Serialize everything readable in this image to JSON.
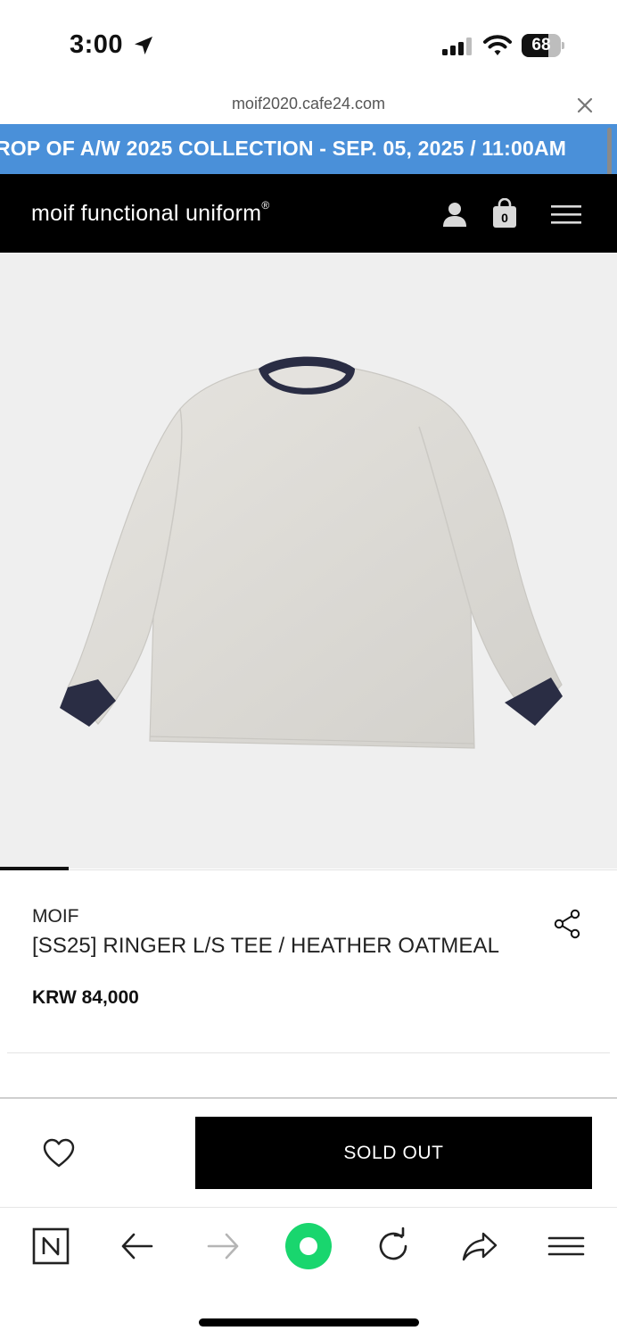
{
  "status_bar": {
    "time": "3:00",
    "battery_level": "68",
    "battery_fraction": 0.68
  },
  "browser": {
    "url": "moif2020.cafe24.com"
  },
  "banner": {
    "text": "ROP OF A/W 2025 COLLECTION - SEP. 05, 2025 / 11:00AM",
    "color": "#4a90d9"
  },
  "header": {
    "logo": "moif functional uniform",
    "logo_mark": "®",
    "cart_count": "0"
  },
  "gallery": {
    "image": "long-sleeve ringer tee, heather oatmeal body with navy collar and cuffs",
    "position": 1
  },
  "product": {
    "brand": "MOIF",
    "name": "[SS25] RINGER L/S TEE / HEATHER OATMEAL",
    "price": "KRW 84,000"
  },
  "purchase": {
    "button_label": "SOLD OUT"
  },
  "icons": {
    "location": "location-arrow-icon",
    "signal": "cell-signal-icon",
    "wifi": "wifi-icon",
    "close": "close-icon",
    "user": "user-icon",
    "bag": "shopping-bag-icon",
    "menu": "hamburger-menu-icon",
    "share": "share-icon",
    "wishlist": "heart-icon",
    "naver": "naver-n-icon",
    "back": "back-arrow-icon",
    "forward": "forward-arrow-icon",
    "green": "green-circle-icon",
    "reload": "reload-icon",
    "share_out": "share-out-icon",
    "browser_menu": "browser-menu-icon"
  }
}
